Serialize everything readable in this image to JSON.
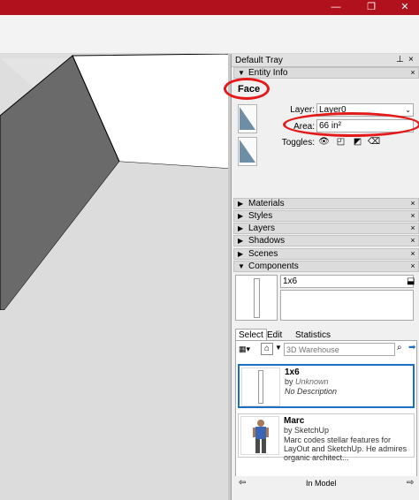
{
  "window": {
    "minimize_glyph": "—",
    "restore_glyph": "❐",
    "close_glyph": "✕"
  },
  "tray": {
    "title": "Default Tray",
    "pin_glyph": "⊥",
    "close_glyph": "×"
  },
  "entity_info": {
    "header": "Entity Info",
    "type": "Face",
    "layer_label": "Layer:",
    "layer_value": "Layer0",
    "area_label": "Area:",
    "area_value": "66 in²",
    "toggles_label": "Toggles:"
  },
  "sections": [
    "Materials",
    "Styles",
    "Layers",
    "Shadows",
    "Scenes"
  ],
  "components": {
    "header": "Components",
    "name_value": "1x6",
    "tabs": [
      "Select",
      "Edit",
      "Statistics"
    ],
    "search_placeholder": "3D Warehouse",
    "results": [
      {
        "name": "1x6",
        "by": "by",
        "author": "Unknown",
        "desc": "No Description"
      },
      {
        "name": "Marc",
        "by": "by",
        "author": "SketchUp",
        "desc": "Marc codes stellar features for LayOut and SketchUp. He admires organic architect..."
      }
    ],
    "collection": "In Model"
  },
  "colors": {
    "titlebar": "#b0111c",
    "highlight_ring": "#e41a1a",
    "selection": "#1d6fc4"
  }
}
